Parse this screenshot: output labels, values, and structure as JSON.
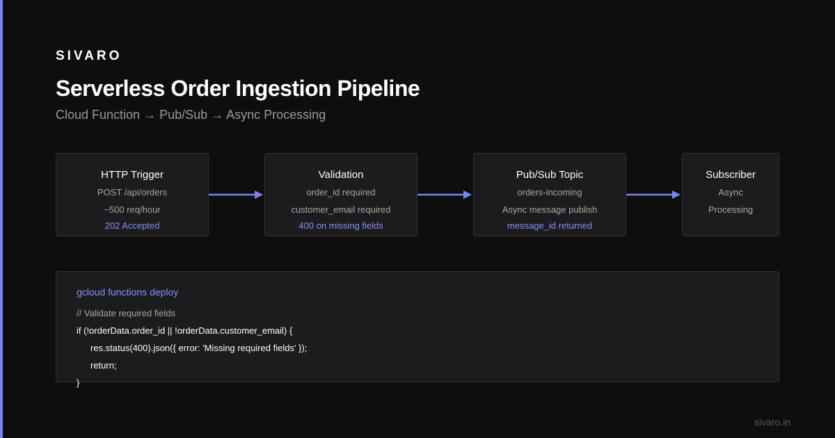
{
  "brand": "SIVARO",
  "title": "Serverless Order Ingestion Pipeline",
  "subtitle": "Cloud Function → Pub/Sub → Async Processing",
  "colors": {
    "background": "#0e0e0e",
    "accent": "#7b83f0",
    "node_fill": "#1c1c1e",
    "node_border": "#333336",
    "highlight_text": "#8a90f5"
  },
  "nodes": [
    {
      "name": "HTTP Trigger",
      "line1": "POST /api/orders",
      "line2": "~500 req/hour",
      "line3": "202 Accepted"
    },
    {
      "name": "Validation",
      "line1": "order_id required",
      "line2": "customer_email required",
      "line3": "400 on missing fields"
    },
    {
      "name": "Pub/Sub Topic",
      "line1": "orders-incoming",
      "line2": "Async message publish",
      "line3": "message_id returned"
    },
    {
      "name": "Subscriber",
      "line1": "Async",
      "line2": "Processing",
      "line3": ""
    }
  ],
  "edges": [
    {
      "from": "HTTP Trigger",
      "to": "Validation"
    },
    {
      "from": "Validation",
      "to": "Pub/Sub Topic"
    },
    {
      "from": "Pub/Sub Topic",
      "to": "Subscriber"
    }
  ],
  "code": {
    "command": "gcloud functions deploy",
    "lines": [
      "// Validate required fields",
      "if (!orderData.order_id || !orderData.customer_email) {",
      "res.status(400).json({ error: 'Missing required fields' });",
      "return;",
      "}"
    ]
  },
  "footer": "sivaro.in"
}
